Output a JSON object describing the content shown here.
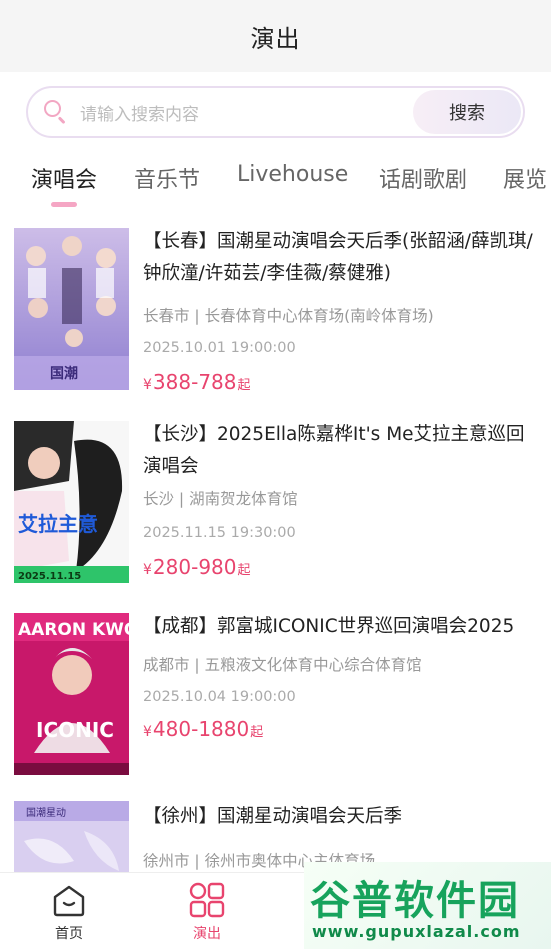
{
  "header": {
    "title": "演出"
  },
  "search": {
    "placeholder": "请输入搜索内容",
    "button_label": "搜索"
  },
  "tabs": [
    {
      "label": "演唱会",
      "active": true
    },
    {
      "label": "音乐节",
      "active": false
    },
    {
      "label": "Livehouse",
      "active": false
    },
    {
      "label": "话剧歌剧",
      "active": false
    },
    {
      "label": "展览",
      "active": false
    }
  ],
  "events": [
    {
      "name": "【长春】国潮星动演唱会天后季(张韶涵/薛凯琪/钟欣潼/许茹芸/李佳薇/蔡健雅)",
      "venue": "长春市 | 长春体育中心体育场(南岭体育场)",
      "time": "2025.10.01 19:00:00",
      "currency": "¥",
      "price": "388-788",
      "price_suffix": "起",
      "poster_text": "国潮"
    },
    {
      "name": "【长沙】2025Ella陈嘉桦It's Me艾拉主意巡回演唱会",
      "venue": "长沙 | 湖南贺龙体育馆",
      "time": "2025.11.15 19:30:00",
      "currency": "¥",
      "price": "280-980",
      "price_suffix": "起",
      "poster_text": "艾拉主意",
      "poster_date": "2025.11.15"
    },
    {
      "name": "【成都】郭富城ICONIC世界巡回演唱会2025",
      "venue": "成都市 | 五粮液文化体育中心综合体育馆",
      "time": "2025.10.04 19:00:00",
      "currency": "¥",
      "price": "480-1880",
      "price_suffix": "起",
      "poster_text": "AARON KWOK",
      "poster_text2": "ICONIC"
    },
    {
      "name": "【徐州】国潮星动演唱会天后季",
      "venue": "徐州市 | 徐州市奥体中心主体育场",
      "time": "",
      "currency": "",
      "price": "",
      "price_suffix": "",
      "poster_text": "国潮星动"
    }
  ],
  "tabbar": {
    "items": [
      {
        "label": "首页",
        "icon": "home-icon",
        "active": false
      },
      {
        "label": "演出",
        "icon": "grid-icon",
        "active": true
      }
    ]
  },
  "watermark": {
    "text": "谷普软件园",
    "url": "www.gupuxlazal.com"
  },
  "colors": {
    "accent": "#e8446e",
    "tab_underline": "#f5a6c4",
    "header_bg": "#f5f5f5"
  }
}
